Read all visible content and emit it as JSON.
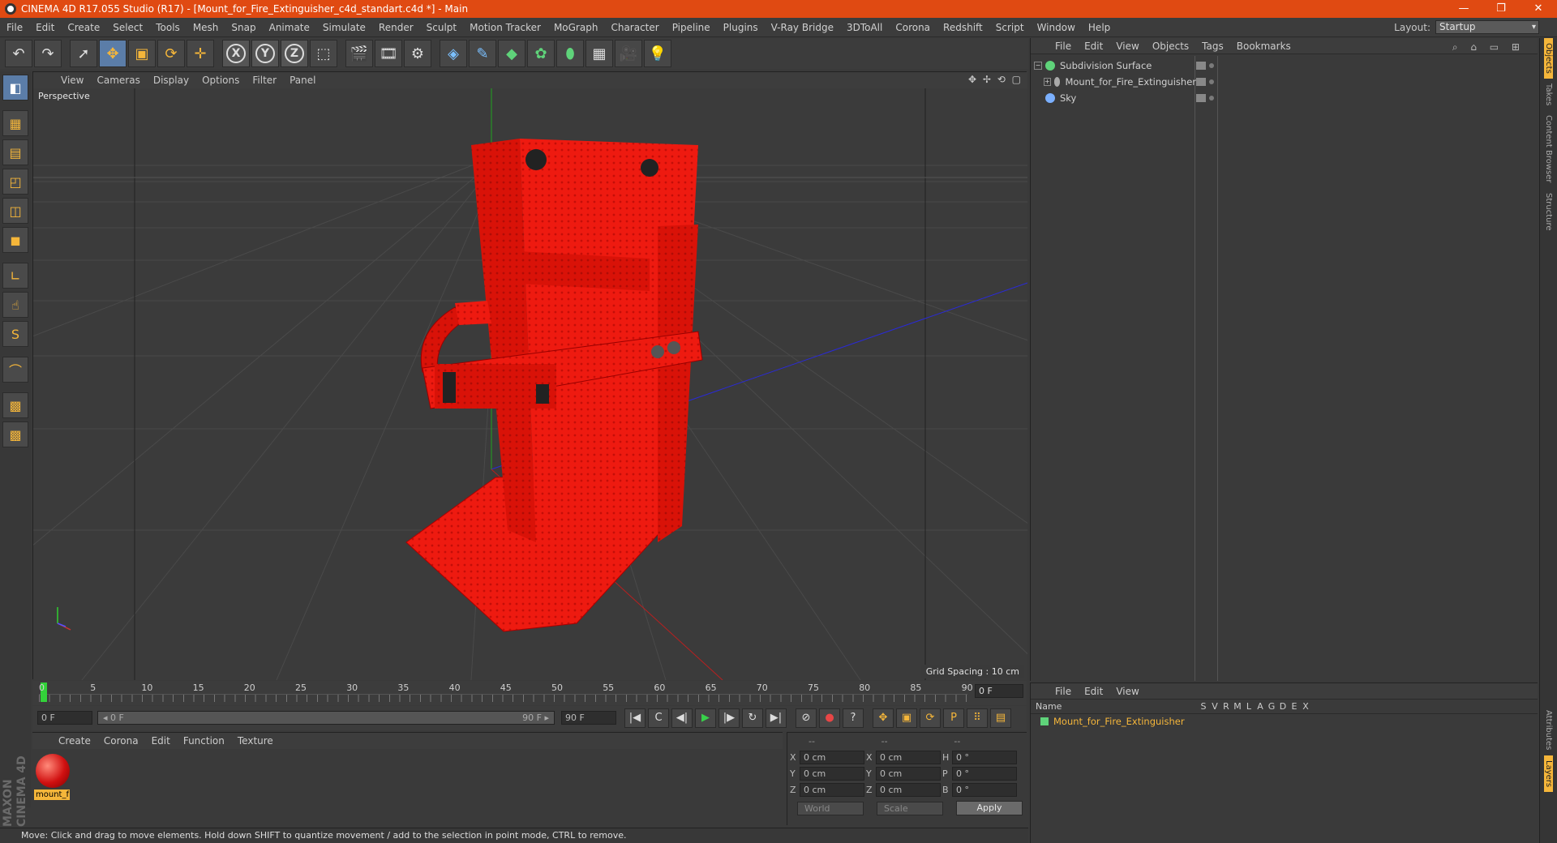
{
  "window": {
    "title": "CINEMA 4D R17.055 Studio (R17) - [Mount_for_Fire_Extinguisher_c4d_standart.c4d *] - Main",
    "min": "—",
    "max": "❐",
    "close": "✕"
  },
  "menu": [
    "File",
    "Edit",
    "Create",
    "Select",
    "Tools",
    "Mesh",
    "Snap",
    "Animate",
    "Simulate",
    "Render",
    "Sculpt",
    "Motion Tracker",
    "MoGraph",
    "Character",
    "Pipeline",
    "Plugins",
    "V-Ray Bridge",
    "3DToAll",
    "Corona",
    "Redshift",
    "Script",
    "Window",
    "Help"
  ],
  "layout": {
    "label": "Layout:",
    "value": "Startup"
  },
  "toolbar": {
    "icons": [
      "undo-icon",
      "redo-icon",
      "select-icon",
      "move-icon",
      "scale-icon",
      "rotate-icon",
      "live-move-icon",
      "x-axis-icon",
      "y-axis-icon",
      "z-axis-icon",
      "coord-system-icon",
      "render-view-icon",
      "render-region-icon",
      "render-settings-icon",
      "cube-icon",
      "pen-icon",
      "subdivision-icon",
      "cloner-icon",
      "deformer-icon",
      "floor-icon",
      "camera-icon",
      "light-icon"
    ],
    "glyphs": [
      "↶",
      "↷",
      "➚",
      "✥",
      "▣",
      "⟳",
      "✛",
      "X",
      "Y",
      "Z",
      "⬚",
      "🎬",
      "🎞",
      "⚙",
      "◈",
      "✎",
      "◆",
      "✿",
      "⬮",
      "▦",
      "🎥",
      "💡"
    ]
  },
  "left_tools": {
    "icons": [
      "model-icon",
      "texture-icon",
      "workplane-icon",
      "points-icon",
      "edges-icon",
      "polygons-icon",
      "axis-icon",
      "tweak-icon",
      "solo-icon",
      "magnet-icon",
      "lock-grid-icon",
      "grid-snap-icon"
    ],
    "glyphs": [
      "◧",
      "▦",
      "▤",
      "◰",
      "◫",
      "◼",
      "∟",
      "☝",
      "S",
      "⌒",
      "▩",
      "▩"
    ]
  },
  "maxon": "MAXON CINEMA 4D",
  "viewport": {
    "menu": [
      "View",
      "Cameras",
      "Display",
      "Options",
      "Filter",
      "Panel"
    ],
    "nav_icons": "✥ ✢ ⟲ ▢",
    "camera": "Perspective",
    "grid_spacing": "Grid Spacing : 10 cm"
  },
  "timeline": {
    "ticks": [
      "0",
      "5",
      "10",
      "15",
      "20",
      "25",
      "30",
      "35",
      "40",
      "45",
      "50",
      "55",
      "60",
      "65",
      "70",
      "75",
      "80",
      "85",
      "90"
    ],
    "current_frame": "0 F"
  },
  "transport": {
    "start": "0 F",
    "range_start": "◂ 0 F",
    "range_end": "90 F ▸",
    "end": "90 F",
    "buttons": [
      "|◀",
      "C",
      "◀|",
      "▶",
      "|▶",
      "↻",
      "▶|",
      "⊘",
      "●",
      "?",
      "✥",
      "▣",
      "⟳",
      "P",
      "⠿",
      "▤"
    ]
  },
  "material_panel": {
    "menu": [
      "Create",
      "Corona",
      "Edit",
      "Function",
      "Texture"
    ],
    "material_name": "mount_f"
  },
  "coords": {
    "headers": [
      "--",
      "--",
      "--"
    ],
    "rows": [
      {
        "a": "X",
        "av": "0 cm",
        "b": "X",
        "bv": "0 cm",
        "c": "H",
        "cv": "0 °"
      },
      {
        "a": "Y",
        "av": "0 cm",
        "b": "Y",
        "bv": "0 cm",
        "c": "P",
        "cv": "0 °"
      },
      {
        "a": "Z",
        "av": "0 cm",
        "b": "Z",
        "bv": "0 cm",
        "c": "B",
        "cv": "0 °"
      }
    ],
    "mode": "World",
    "size_mode": "Scale",
    "apply": "Apply"
  },
  "status": "Move: Click and drag to move elements. Hold down SHIFT to quantize movement / add to the selection in point mode, CTRL to remove.",
  "object_manager": {
    "menu": [
      "File",
      "Edit",
      "View",
      "Objects",
      "Tags",
      "Bookmarks"
    ],
    "objects": [
      {
        "name": "Subdivision Surface",
        "color": "#5fd37a"
      },
      {
        "name": "Mount_for_Fire_Extinguisher",
        "color": "#aaaaaa"
      },
      {
        "name": "Sky",
        "color": "#7bb0ff"
      }
    ]
  },
  "layer_manager": {
    "menu": [
      "File",
      "Edit",
      "View"
    ],
    "col_name": "Name",
    "cols": [
      "S",
      "V",
      "R",
      "M",
      "L",
      "A",
      "G",
      "D",
      "E",
      "X"
    ],
    "layer": "Mount_for_Fire_Extinguisher"
  },
  "side_tabs": [
    "Objects",
    "Takes",
    "Content Browser",
    "Structure",
    "Attributes",
    "Layers"
  ]
}
